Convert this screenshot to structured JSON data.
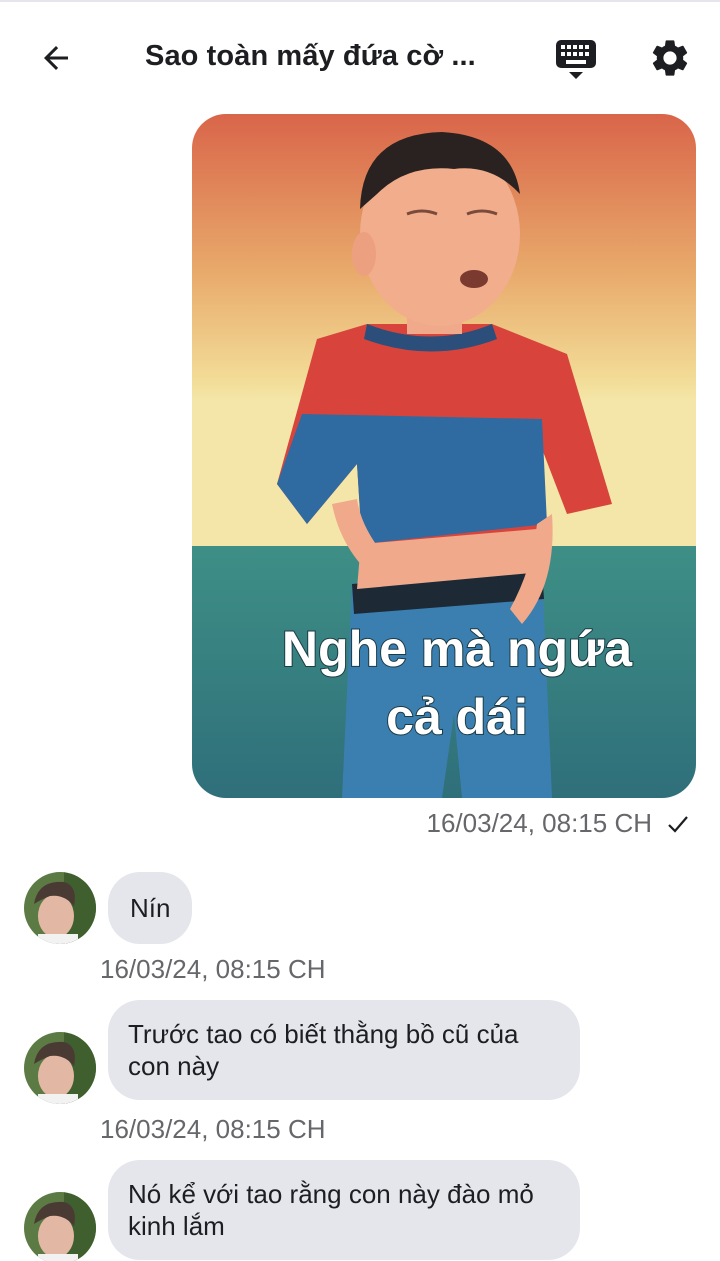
{
  "header": {
    "title": "Sao toàn mấy đứa cờ ..."
  },
  "icons": {
    "back": "arrow-left-icon",
    "keyboard": "keyboard-icon",
    "settings": "gear-icon",
    "sent_status": "checkmark-icon"
  },
  "messages": {
    "sent_image": {
      "caption": [
        "Nghe mà ngứa",
        "cả dái"
      ],
      "time": "16/03/24, 08:15 CH"
    },
    "received": [
      {
        "text": "Nín",
        "time": "16/03/24, 08:15 CH"
      },
      {
        "text": "Trước tao có biết thằng bồ cũ của con này",
        "time": "16/03/24, 08:15 CH"
      },
      {
        "text": "Nó kể với tao rằng con này đào mỏ kinh lắm"
      }
    ]
  },
  "colors": {
    "bubble_bg": "#e4e6eb",
    "timestamp": "#65676b",
    "text": "#1c1e21"
  }
}
